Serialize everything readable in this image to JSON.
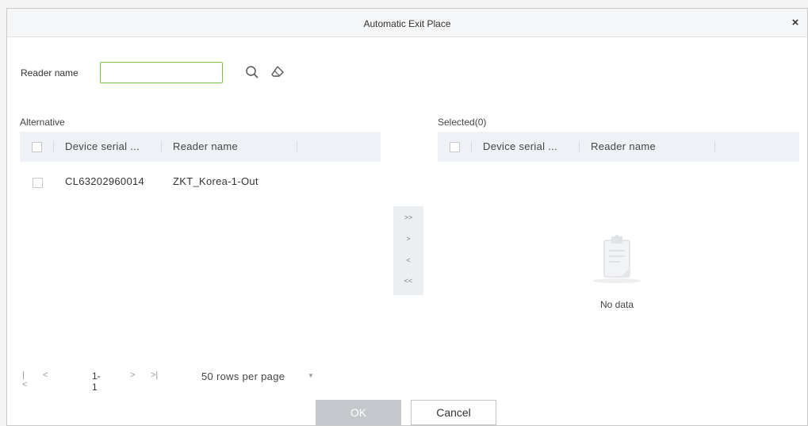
{
  "dialog": {
    "title": "Automatic Exit Place",
    "close_symbol": "×"
  },
  "search": {
    "label": "Reader name",
    "value": "",
    "placeholder": ""
  },
  "alternative": {
    "label": "Alternative",
    "columns": [
      "Device serial ...",
      "Reader name"
    ],
    "rows": [
      {
        "serial": "CL63202960014",
        "reader": "ZKT_Korea-1-Out"
      }
    ]
  },
  "selected": {
    "label": "Selected(0)",
    "columns": [
      "Device serial ...",
      "Reader name"
    ],
    "empty_text": "No data"
  },
  "transfer": {
    "all_right": ">>",
    "right": ">",
    "left": "<",
    "all_left": "<<"
  },
  "pagination": {
    "first": "|<",
    "prev": "<",
    "range": "1-1",
    "next": ">",
    "last": ">|",
    "rows_per_page": "50 rows per page"
  },
  "footer": {
    "ok": "OK",
    "cancel": "Cancel"
  },
  "colors": {
    "accent": "#7ac143",
    "header_bg": "#eef2f6",
    "ok_disabled": "#c4c8cc"
  },
  "icons": {
    "search": "search-icon",
    "clear": "eraser-icon",
    "empty": "clipboard-icon"
  }
}
